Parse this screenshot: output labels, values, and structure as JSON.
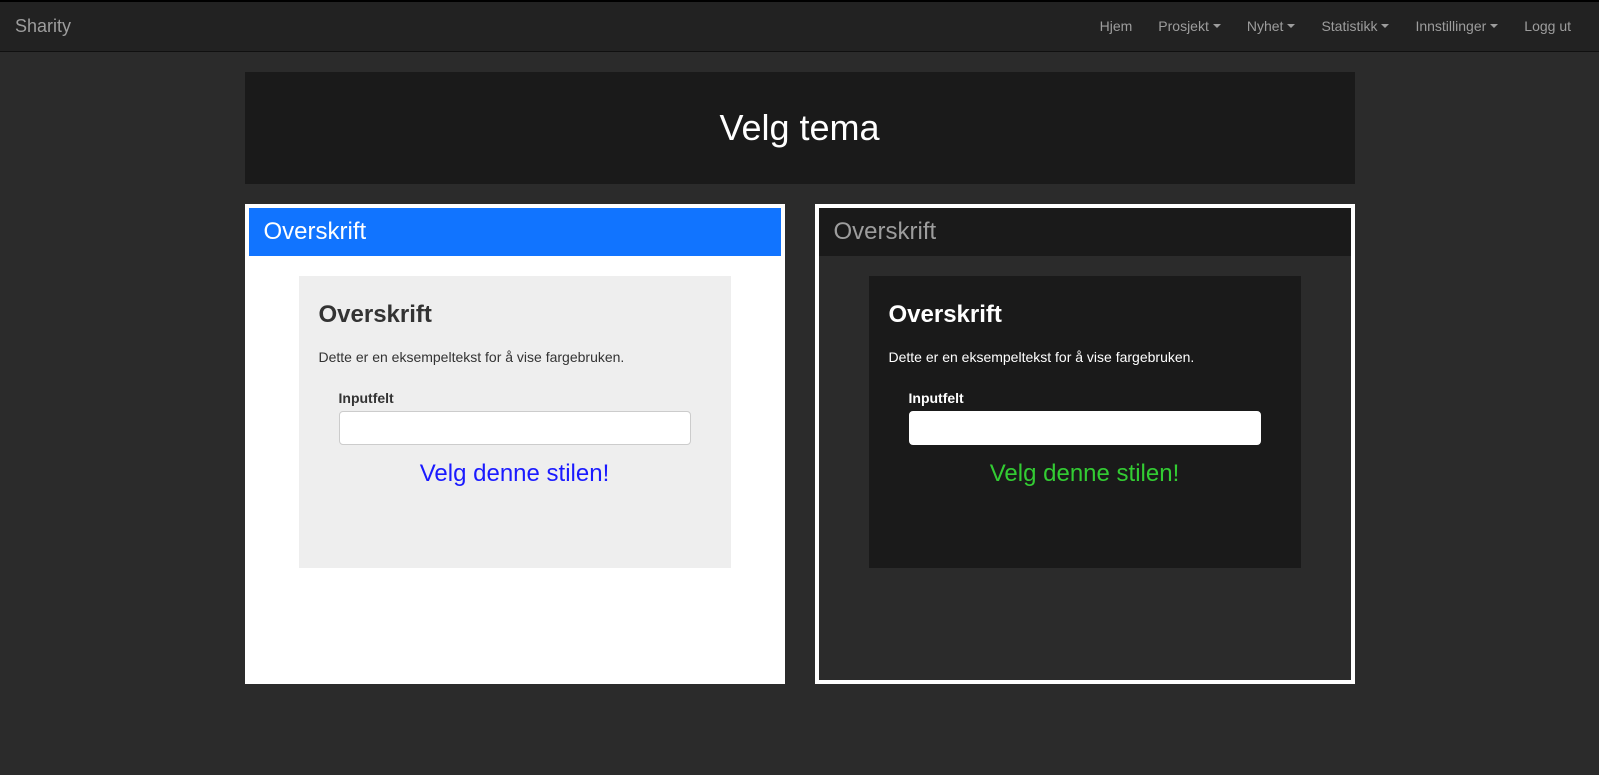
{
  "navbar": {
    "brand": "Sharity",
    "items": [
      {
        "label": "Hjem",
        "dropdown": false
      },
      {
        "label": "Prosjekt",
        "dropdown": true
      },
      {
        "label": "Nyhet",
        "dropdown": true
      },
      {
        "label": "Statistikk",
        "dropdown": true
      },
      {
        "label": "Innstillinger",
        "dropdown": true
      },
      {
        "label": "Logg ut",
        "dropdown": false
      }
    ]
  },
  "page": {
    "title": "Velg tema"
  },
  "themes": {
    "light": {
      "outer_heading": "Overskrift",
      "inner_heading": "Overskrift",
      "sample_text": "Dette er en eksempeltekst for å vise fargebruken.",
      "input_label": "Inputfelt",
      "select_label": "Velg denne stilen!"
    },
    "dark": {
      "outer_heading": "Overskrift",
      "inner_heading": "Overskrift",
      "sample_text": "Dette er en eksempeltekst for å vise fargebruken.",
      "input_label": "Inputfelt",
      "select_label": "Velg denne stilen!"
    }
  }
}
